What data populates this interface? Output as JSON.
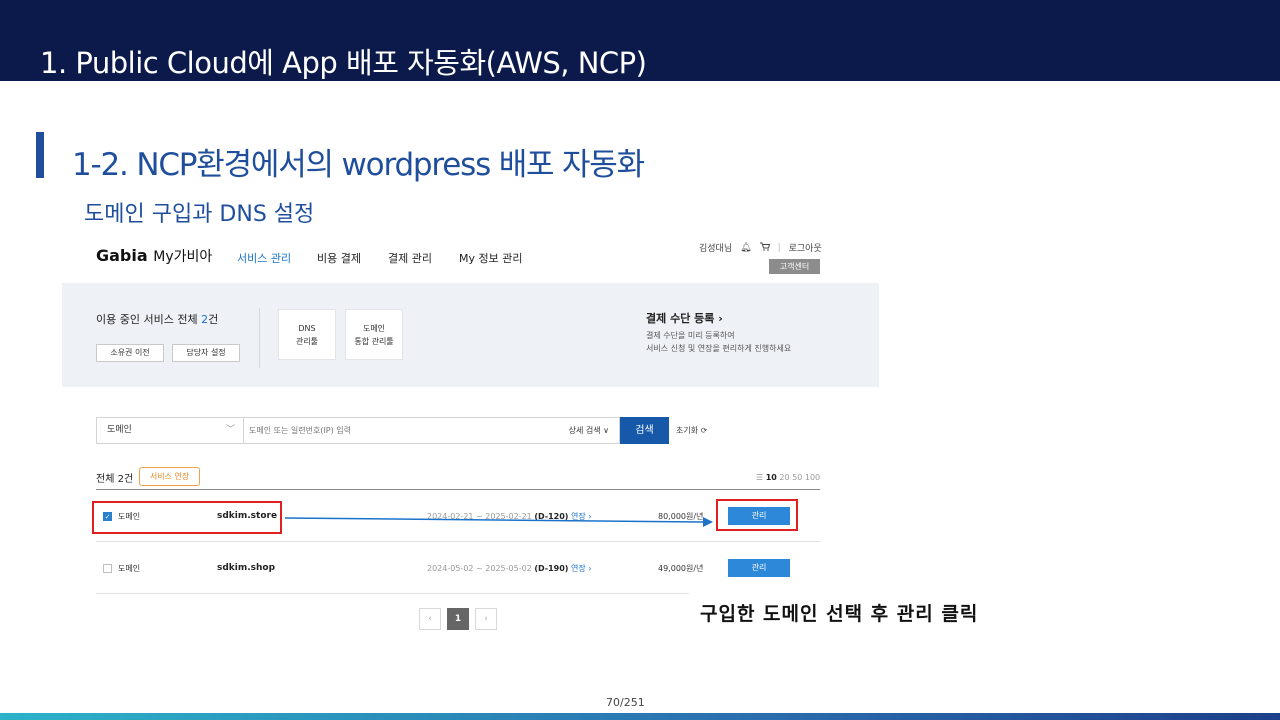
{
  "slide": {
    "title": "1. Public Cloud에 App 배포 자동화(AWS, NCP)",
    "section_title": "1-2. NCP환경에서의 wordpress 배포 자동화",
    "section_sub": "도메인 구입과 DNS 설정",
    "instruction": "구입한 도메인 선택 후 관리 클릭",
    "page_number": "70/251"
  },
  "gabia": {
    "logo": "Gabia",
    "logo_sub": "My가비아",
    "nav": [
      "서비스 관리",
      "비용 결제",
      "결제 관리",
      "My 정보 관리"
    ],
    "user": "김성대님",
    "logout": "로그아웃",
    "customer_center": "고객센터",
    "summary": {
      "title_prefix": "이용 중인 서비스 전체",
      "count": "2",
      "title_suffix": "건",
      "btn_transfer": "소유권 이전",
      "btn_manager": "담당자 설정",
      "card_dns_1": "DNS",
      "card_dns_2": "관리툴",
      "card_domain_1": "도메인",
      "card_domain_2": "통합 관리툴",
      "pay_title": "결제 수단 등록 ›",
      "pay_desc_1": "결제 수단을 미리 등록하여",
      "pay_desc_2": "서비스 신청 및 연장을 편리하게 진행하세요"
    },
    "search": {
      "select": "도메인",
      "placeholder": "도메인 또는 일련번호(IP) 입력",
      "advanced": "상세 검색",
      "button": "검색",
      "reset": "초기화"
    },
    "list": {
      "total": "전체 2건",
      "renew_button": "서비스 연장",
      "page_sizes": [
        "10",
        "20",
        "50",
        "100"
      ],
      "rows": [
        {
          "type": "도메인",
          "domain": "sdkim.store",
          "period": "2024-02-21 ~ 2025-02-21",
          "dday": "(D-120)",
          "renew": "연장 ›",
          "price": "80,000원/년",
          "manage": "관리",
          "checked": true
        },
        {
          "type": "도메인",
          "domain": "sdkim.shop",
          "period": "2024-05-02 ~ 2025-05-02",
          "dday": "(D-190)",
          "renew": "연장 ›",
          "price": "49,000원/년",
          "manage": "관리",
          "checked": false
        }
      ]
    },
    "pager": {
      "prev": "‹",
      "current": "1",
      "next": "›"
    }
  },
  "colors": {
    "header_bg": "#0b1a4a",
    "accent_blue": "#1f4f9c",
    "highlight_red": "#e02020",
    "manage_button": "#2d88d9"
  }
}
